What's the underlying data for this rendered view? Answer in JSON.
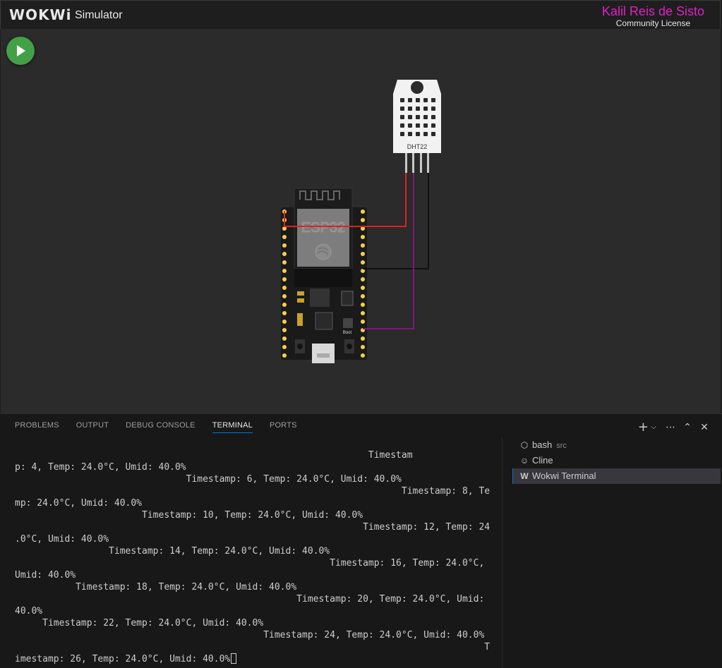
{
  "header": {
    "logo": "WOKWi",
    "title": "Simulator",
    "license_user": "Kalil Reis de Sisto",
    "license_type": "Community License"
  },
  "simulator": {
    "dht_label": "DHT22",
    "board_label": "ESP32",
    "boot_label": "Boot"
  },
  "panel": {
    "tabs": [
      "PROBLEMS",
      "OUTPUT",
      "DEBUG CONSOLE",
      "TERMINAL",
      "PORTS"
    ],
    "active_tab": "TERMINAL",
    "terminal_lines": [
      "                                                                Timestam",
      "p: 4, Temp: 24.0°C, Umid: 40.0%",
      "                               Timestamp: 6, Temp: 24.0°C, Umid: 40.0%",
      "                                                                      Timestamp: 8, Te",
      "mp: 24.0°C, Umid: 40.0%",
      "                       Timestamp: 10, Temp: 24.0°C, Umid: 40.0%",
      "                                                               Timestamp: 12, Temp: 24",
      ".0°C, Umid: 40.0%",
      "                 Timestamp: 14, Temp: 24.0°C, Umid: 40.0%",
      "                                                         Timestamp: 16, Temp: 24.0°C,",
      "Umid: 40.0%",
      "           Timestamp: 18, Temp: 24.0°C, Umid: 40.0%",
      "                                                   Timestamp: 20, Temp: 24.0°C, Umid:",
      "40.0%",
      "     Timestamp: 22, Temp: 24.0°C, Umid: 40.0%",
      "                                             Timestamp: 24, Temp: 24.0°C, Umid: 40.0%",
      "                                                                                     T",
      "imestamp: 26, Temp: 24.0°C, Umid: 40.0%"
    ],
    "terminals": [
      {
        "label": "bash",
        "sub": "src",
        "icon": "terminal-icon"
      },
      {
        "label": "Cline",
        "sub": "",
        "icon": "robot-icon"
      },
      {
        "label": "Wokwi Terminal",
        "sub": "",
        "icon": "wokwi-icon"
      }
    ]
  },
  "colors": {
    "accent": "#0078d4",
    "license_user": "#e020c8",
    "play": "#43a047",
    "wire_red": "#e02020",
    "wire_black": "#111111",
    "wire_purple": "#7a1a7a"
  }
}
